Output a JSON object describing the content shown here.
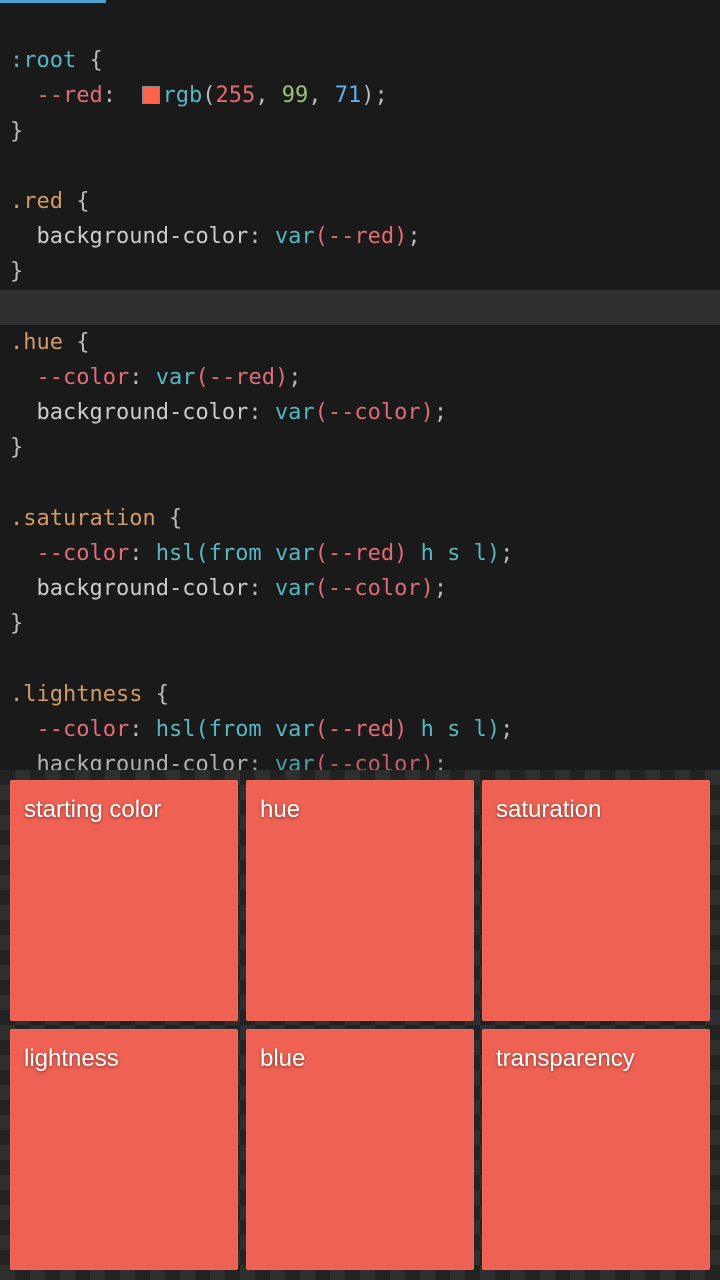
{
  "colors": {
    "tomato": "#ff6347",
    "rgb": {
      "r": "255",
      "g": "99",
      "b": "71"
    }
  },
  "code": {
    "root_sel": ":root",
    "open_brace": " {",
    "close_brace": "}",
    "var_red": "--red",
    "var_color": "--color",
    "rgb_fn": "rgb",
    "hsl_expr_open": "hsl(from ",
    "var_fn": "var",
    "var_red_call": "(--red)",
    "var_color_call": "(--color)",
    "hsl_tail": " h s l)",
    "prop_bg": "background-color",
    "prop_bg_trunc": "hackground-color",
    "colon_sp": ": ",
    "semi": ";",
    "comma_sp": ", ",
    "paren_o": "(",
    "paren_c": ")",
    "sel_red": ".red",
    "sel_hue": ".hue",
    "sel_sat": ".saturation",
    "sel_light": ".lightness"
  },
  "cards": [
    {
      "label": "starting color",
      "bg": "#ef6253"
    },
    {
      "label": "hue",
      "bg": "#ef6253"
    },
    {
      "label": "saturation",
      "bg": "#ef6253"
    },
    {
      "label": "lightness",
      "bg": "#ef6253"
    },
    {
      "label": "blue",
      "bg": "#ef6253"
    },
    {
      "label": "transparency",
      "bg": "#ef6253"
    }
  ]
}
